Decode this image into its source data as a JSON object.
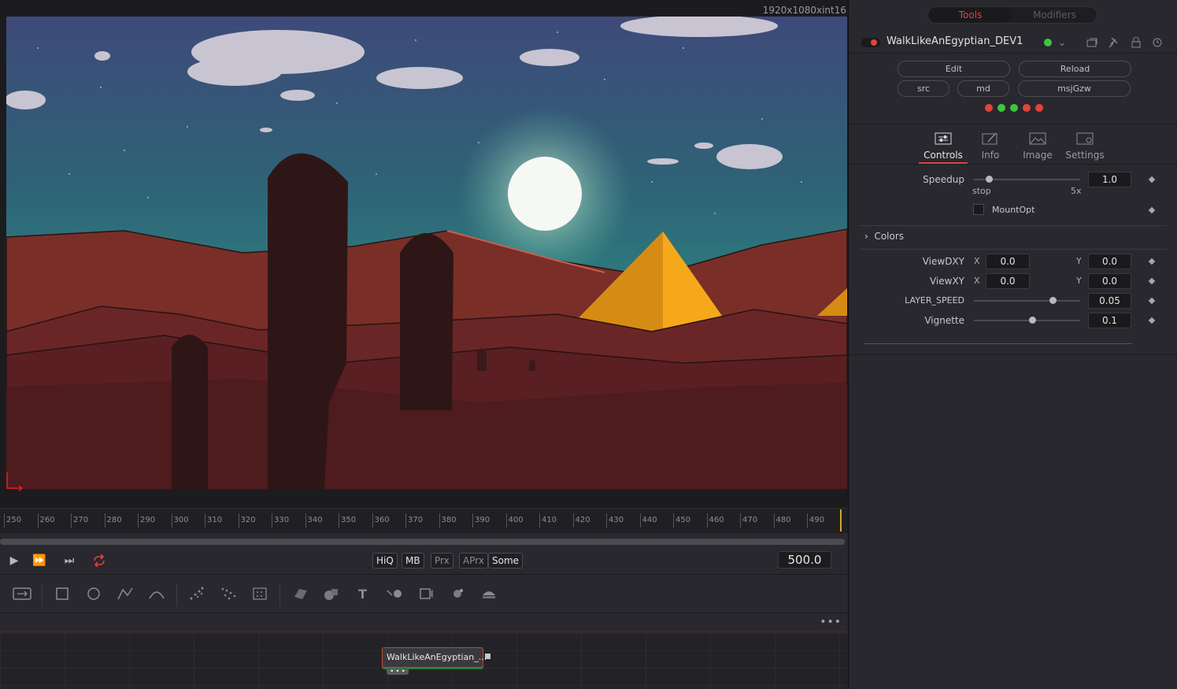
{
  "viewer": {
    "resolution": "1920x1080xint16"
  },
  "timeline": {
    "ticks": [
      "250",
      "260",
      "270",
      "280",
      "290",
      "300",
      "310",
      "320",
      "330",
      "340",
      "350",
      "360",
      "370",
      "380",
      "390",
      "400",
      "410",
      "420",
      "430",
      "440",
      "450",
      "460",
      "470",
      "480",
      "490"
    ],
    "current_frame": "500.0"
  },
  "transport": {
    "quality_buttons": [
      "HiQ",
      "MB",
      "Prx",
      "APrx",
      "Some"
    ]
  },
  "node_editor": {
    "node_label": "WalkLikeAnEgyptian_...",
    "more_label": "•••"
  },
  "inspector": {
    "tabs_top": {
      "tools": "Tools",
      "modifiers": "Modifiers"
    },
    "tool_name": "WalkLikeAnEgyptian_DEV1",
    "buttons": {
      "edit": "Edit",
      "reload": "Reload",
      "src": "src",
      "md": "md",
      "msj": "msjGzw"
    },
    "color_dots": [
      "#e0443a",
      "#3ec43e",
      "#3ec43e",
      "#e0443a",
      "#e0443a"
    ],
    "tabs": {
      "controls": "Controls",
      "info": "Info",
      "image": "Image",
      "settings": "Settings"
    },
    "speedup": {
      "label": "Speedup",
      "value": "1.0",
      "min_label": "stop",
      "max_label": "5x",
      "level": 0.14
    },
    "mountopt": {
      "label": "MountOpt"
    },
    "colors_section": "Colors",
    "viewdxy": {
      "label": "ViewDXY",
      "x_label": "X",
      "x": "0.0",
      "y_label": "Y",
      "y": "0.0"
    },
    "viewxy": {
      "label": "ViewXY",
      "x_label": "X",
      "x": "0.0",
      "y_label": "Y",
      "y": "0.0"
    },
    "layer_speed": {
      "label": "LAYER_SPEED",
      "value": "0.05",
      "level": 0.74
    },
    "vignette": {
      "label": "Vignette",
      "value": "0.1",
      "level": 0.55
    }
  },
  "accent_color": "#e0443a"
}
